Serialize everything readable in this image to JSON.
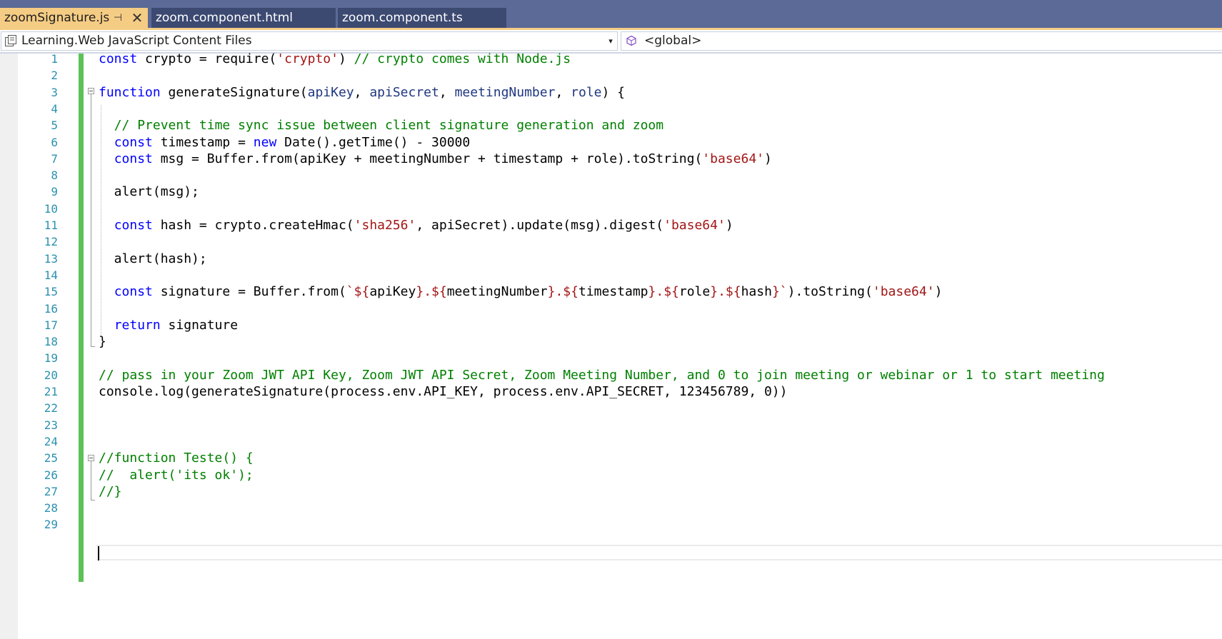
{
  "tabs": [
    {
      "label": "zoomSignature.js",
      "active": true
    },
    {
      "label": "zoom.component.html",
      "active": false
    },
    {
      "label": "zoom.component.ts",
      "active": false
    }
  ],
  "tab_glyphs": {
    "pin": "⊣",
    "close": "✕"
  },
  "nav": {
    "project": "Learning.Web JavaScript Content Files",
    "dropdown_glyph": "▾",
    "scope": "<global>"
  },
  "colors": {
    "tabstrip": "#5b6a96",
    "active_tab": "#f5cc84",
    "inactive_tab": "#3c4a72",
    "keyword": "#0000ff",
    "string": "#a31515",
    "comment": "#008000",
    "parameter": "#1f377f",
    "line_number": "#2b91af",
    "change_bar": "#5dc256"
  },
  "icons": {
    "project": "project-file-icon",
    "scope": "global-scope-icon",
    "pin": "pin-icon",
    "close": "close-icon"
  },
  "editor": {
    "caret_line": 28,
    "lines": [
      [
        {
          "t": "const",
          "c": "kw"
        },
        {
          "t": " crypto = require("
        },
        {
          "t": "'crypto'",
          "c": "str"
        },
        {
          "t": ") "
        },
        {
          "t": "// crypto comes with Node.js",
          "c": "cm"
        }
      ],
      [],
      [
        {
          "t": "function",
          "c": "kw"
        },
        {
          "t": " generateSignature("
        },
        {
          "t": "apiKey",
          "c": "pm"
        },
        {
          "t": ", "
        },
        {
          "t": "apiSecret",
          "c": "pm"
        },
        {
          "t": ", "
        },
        {
          "t": "meetingNumber",
          "c": "pm"
        },
        {
          "t": ", "
        },
        {
          "t": "role",
          "c": "pm"
        },
        {
          "t": ") {"
        }
      ],
      [],
      [
        {
          "t": "  "
        },
        {
          "t": "// Prevent time sync issue between client signature generation and zoom",
          "c": "cm"
        }
      ],
      [
        {
          "t": "  "
        },
        {
          "t": "const",
          "c": "kw"
        },
        {
          "t": " timestamp = "
        },
        {
          "t": "new",
          "c": "kw"
        },
        {
          "t": " Date().getTime() - 30000"
        }
      ],
      [
        {
          "t": "  "
        },
        {
          "t": "const",
          "c": "kw"
        },
        {
          "t": " msg = Buffer.from(apiKey + meetingNumber + timestamp + role).toString("
        },
        {
          "t": "'base64'",
          "c": "str"
        },
        {
          "t": ")"
        }
      ],
      [],
      [
        {
          "t": "  alert(msg);"
        }
      ],
      [],
      [
        {
          "t": "  "
        },
        {
          "t": "const",
          "c": "kw"
        },
        {
          "t": " hash = crypto.createHmac("
        },
        {
          "t": "'sha256'",
          "c": "str"
        },
        {
          "t": ", apiSecret).update(msg).digest("
        },
        {
          "t": "'base64'",
          "c": "str"
        },
        {
          "t": ")"
        }
      ],
      [],
      [
        {
          "t": "  alert(hash);"
        }
      ],
      [],
      [
        {
          "t": "  "
        },
        {
          "t": "const",
          "c": "kw"
        },
        {
          "t": " signature = Buffer.from("
        },
        {
          "t": "`${",
          "c": "tpl"
        },
        {
          "t": "apiKey"
        },
        {
          "t": "}.${",
          "c": "tpl"
        },
        {
          "t": "meetingNumber"
        },
        {
          "t": "}.${",
          "c": "tpl"
        },
        {
          "t": "timestamp"
        },
        {
          "t": "}.${",
          "c": "tpl"
        },
        {
          "t": "role"
        },
        {
          "t": "}.${",
          "c": "tpl"
        },
        {
          "t": "hash"
        },
        {
          "t": "}`",
          "c": "tpl"
        },
        {
          "t": ").toString("
        },
        {
          "t": "'base64'",
          "c": "str"
        },
        {
          "t": ")"
        }
      ],
      [],
      [
        {
          "t": "  "
        },
        {
          "t": "return",
          "c": "kw"
        },
        {
          "t": " signature"
        }
      ],
      [
        {
          "t": "}"
        }
      ],
      [],
      [
        {
          "t": "// pass in your Zoom JWT API Key, Zoom JWT API Secret, Zoom Meeting Number, and 0 to join meeting or webinar or 1 to start meeting",
          "c": "cm"
        }
      ],
      [
        {
          "t": "console.log(generateSignature(process.env.API_KEY, process.env.API_SECRET, 123456789, 0))"
        }
      ],
      [],
      [],
      [],
      [
        {
          "t": "//function Teste() {",
          "c": "cm"
        }
      ],
      [
        {
          "t": "//  alert('its ok');",
          "c": "cm"
        }
      ],
      [
        {
          "t": "//}",
          "c": "cm"
        }
      ],
      [],
      []
    ]
  }
}
